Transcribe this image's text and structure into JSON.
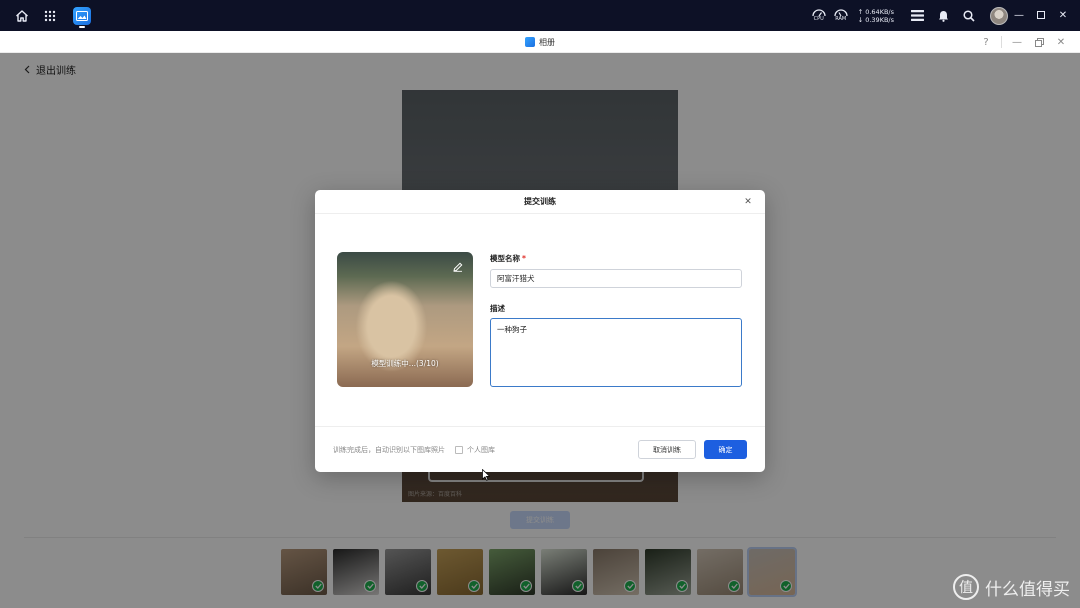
{
  "taskbar": {
    "gauges": [
      "CPU",
      "RAM"
    ],
    "net_up": "↑ 0.64KB/s",
    "net_down": "↓ 0.39KB/s"
  },
  "window": {
    "title": "相册"
  },
  "page": {
    "back_label": "退出训练",
    "submit_label": "提交训练",
    "photo_watermark": "图片来源：百度百科"
  },
  "modal": {
    "title": "提交训练",
    "progress_text": "模型训练中...(3/10)",
    "name_label": "模型名称",
    "name_required": "*",
    "name_value": "阿富汗猎犬",
    "desc_label": "描述",
    "desc_value": "一种狗子",
    "footer_note": "训练完成后，自动识别以下图库照片",
    "checkbox_label": "个人图库",
    "cancel_label": "取消训练",
    "ok_label": "确定"
  },
  "thumbnails": [
    {
      "colors": [
        "#b89a7e",
        "#6d5a48"
      ],
      "checked": true
    },
    {
      "colors": [
        "#2b2b2b",
        "#d8d6d4"
      ],
      "checked": true
    },
    {
      "colors": [
        "#9a9a9a",
        "#3a3a3a"
      ],
      "checked": true
    },
    {
      "colors": [
        "#c7a25a",
        "#8a6a32"
      ],
      "checked": true
    },
    {
      "colors": [
        "#7fa76c",
        "#2f3a2a"
      ],
      "checked": true
    },
    {
      "colors": [
        "#dfe7d9",
        "#2a2a2a"
      ],
      "checked": true
    },
    {
      "colors": [
        "#8a7a6a",
        "#d4c7b5"
      ],
      "checked": true
    },
    {
      "colors": [
        "#2e3a2a",
        "#a0a89a"
      ],
      "checked": true
    },
    {
      "colors": [
        "#d3c7b8",
        "#9b8a76"
      ],
      "checked": true
    },
    {
      "colors": [
        "#c9c2bb",
        "#d8b99a"
      ],
      "checked": true,
      "selected": true
    }
  ],
  "site_watermark": "什么值得买",
  "colors": {
    "primary": "#1d5fe0",
    "taskbar": "#0d1126",
    "check": "#1fb14f"
  }
}
